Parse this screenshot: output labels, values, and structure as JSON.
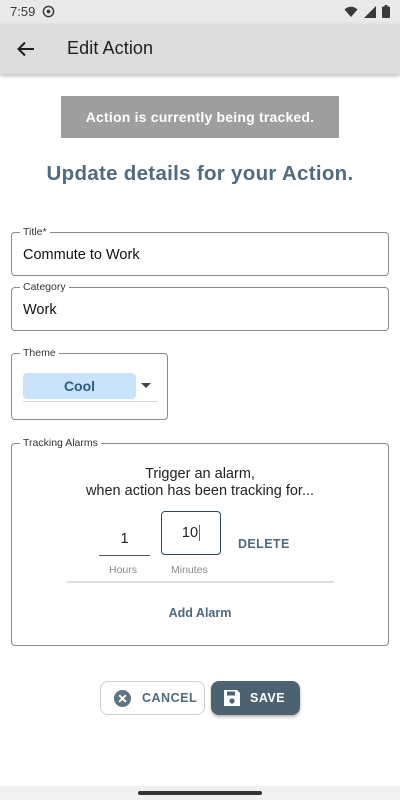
{
  "status_bar": {
    "time": "7:59",
    "icons": [
      "at-sign-icon",
      "wifi-icon",
      "signal-icon",
      "battery-icon"
    ]
  },
  "app_bar": {
    "title": "Edit Action",
    "back_icon": "arrow-left-icon"
  },
  "banner": {
    "text": "Action is currently being tracked."
  },
  "heading": "Update details for your Action.",
  "form": {
    "title": {
      "label": "Title*",
      "value": "Commute to Work"
    },
    "category": {
      "label": "Category",
      "value": "Work"
    },
    "theme": {
      "label": "Theme",
      "value": "Cool"
    },
    "tracking_alarms": {
      "label": "Tracking Alarms",
      "prompt_line1": "Trigger an alarm,",
      "prompt_line2": "when action has been tracking for...",
      "hours_value": "1",
      "minutes_value": "10",
      "hours_label": "Hours",
      "minutes_label": "Minutes",
      "delete_label": "DELETE",
      "add_alarm_label": "Add Alarm"
    }
  },
  "actions": {
    "cancel_label": "CANCEL",
    "save_label": "SAVE"
  },
  "colors": {
    "accent": "#4d6a7e",
    "banner_bg": "#9e9e9e",
    "chip_bg": "#c9e3fb",
    "save_bg": "#4d6270"
  }
}
